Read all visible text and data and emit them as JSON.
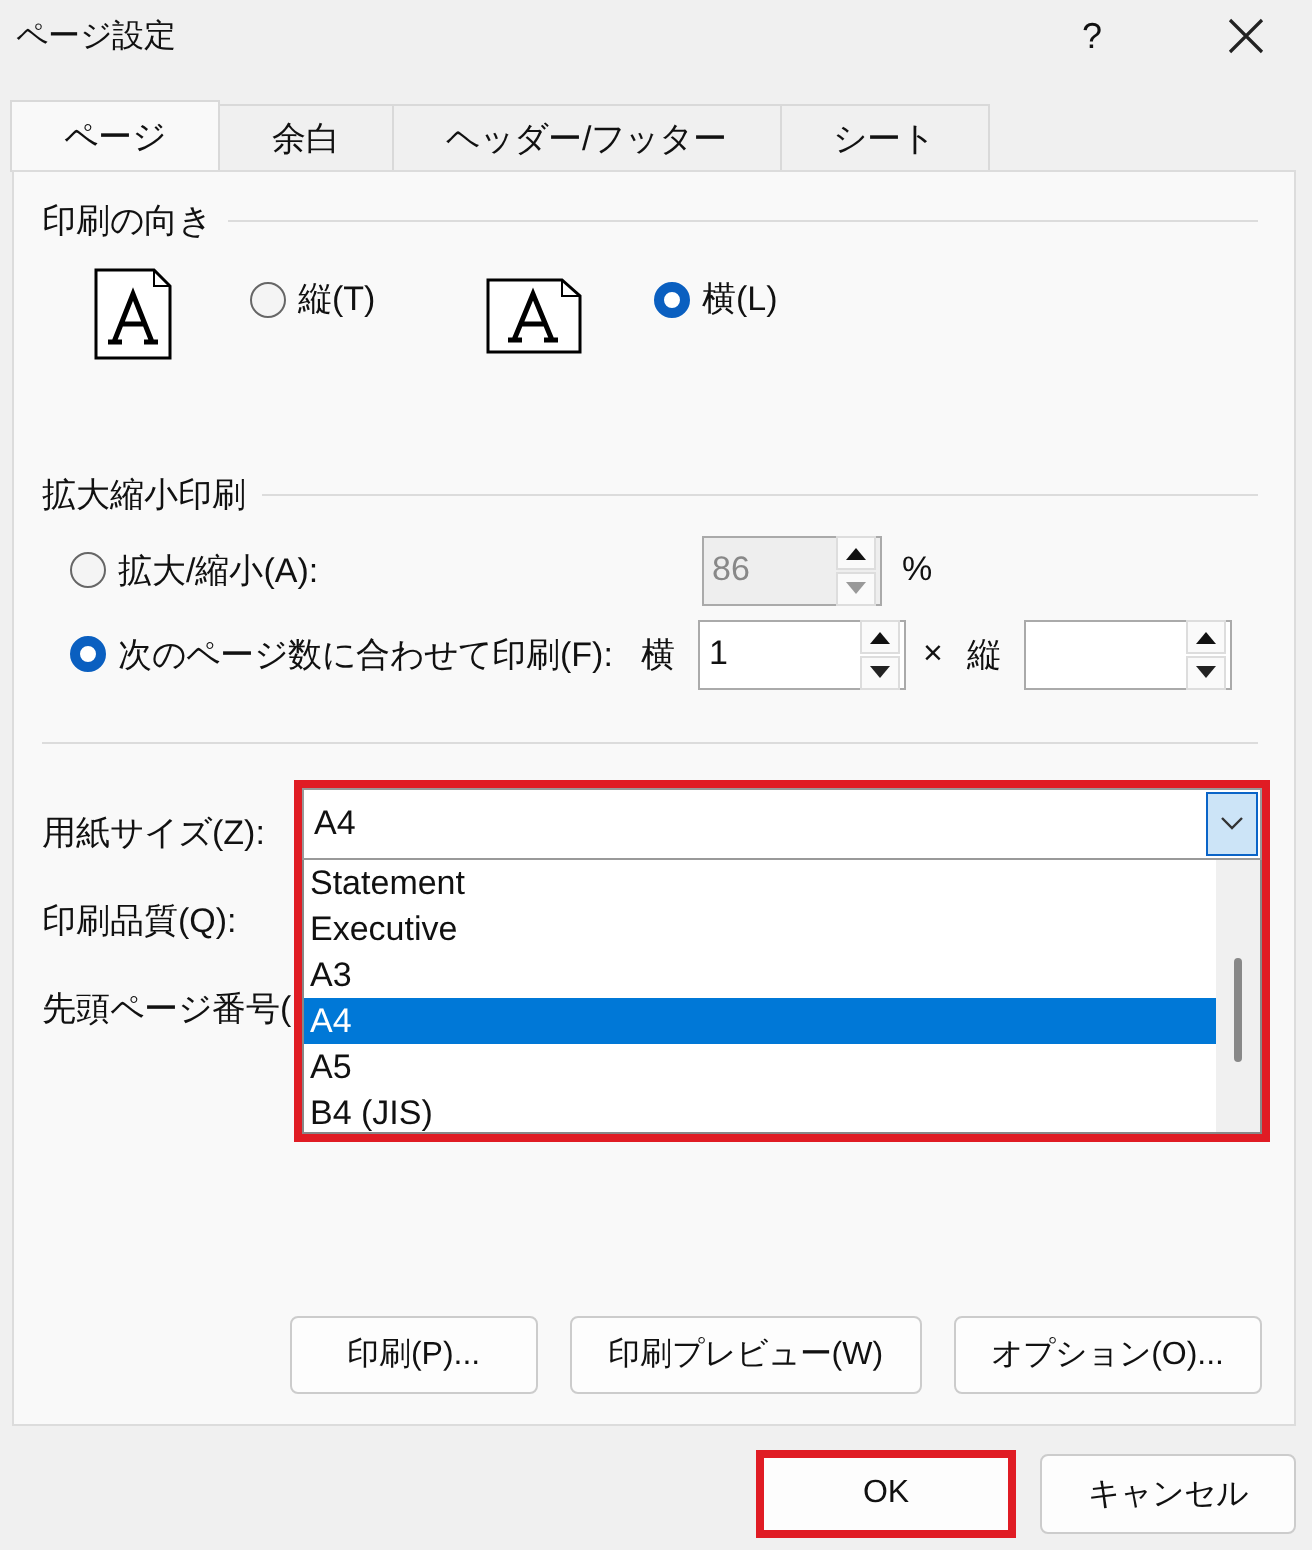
{
  "window": {
    "title": "ページ設定",
    "help": "?"
  },
  "tabs": [
    {
      "label": "ページ",
      "selected": true
    },
    {
      "label": "余白",
      "selected": false
    },
    {
      "label": "ヘッダー/フッター",
      "selected": false
    },
    {
      "label": "シート",
      "selected": false
    }
  ],
  "orientation": {
    "title": "印刷の向き",
    "options": [
      {
        "kind": "portrait",
        "label": "縦(T)",
        "selected": false
      },
      {
        "kind": "landscape",
        "label": "横(L)",
        "selected": true
      }
    ]
  },
  "scaling": {
    "title": "拡大縮小印刷",
    "options": [
      {
        "kind": "percent",
        "label": "拡大/縮小(A):",
        "selected": false,
        "value": "86",
        "disabled": true,
        "unit": "%"
      },
      {
        "kind": "fit",
        "label": "次のページ数に合わせて印刷(F):",
        "selected": true,
        "wide_label": "横",
        "wide_value": "1",
        "times": "×",
        "tall_label": "縦"
      }
    ]
  },
  "paper_size": {
    "label": "用紙サイズ(Z):",
    "value": "A4",
    "expanded": true,
    "highlighted": true,
    "options": [
      {
        "label": "Statement",
        "selected": false
      },
      {
        "label": "Executive",
        "selected": false
      },
      {
        "label": "A3",
        "selected": false
      },
      {
        "label": "A4",
        "selected": true
      },
      {
        "label": "A5",
        "selected": false
      },
      {
        "label": "B4 (JIS)",
        "selected": false
      }
    ]
  },
  "fields": [
    {
      "label": "印刷品質(Q):"
    },
    {
      "label": "先頭ページ番号("
    }
  ],
  "actions": [
    "印刷(P)...",
    "印刷プレビュー(W)",
    "オプション(O)..."
  ],
  "buttons": [
    {
      "label": "OK",
      "highlighted": true
    },
    {
      "label": "キャンセル",
      "highlighted": false
    }
  ]
}
